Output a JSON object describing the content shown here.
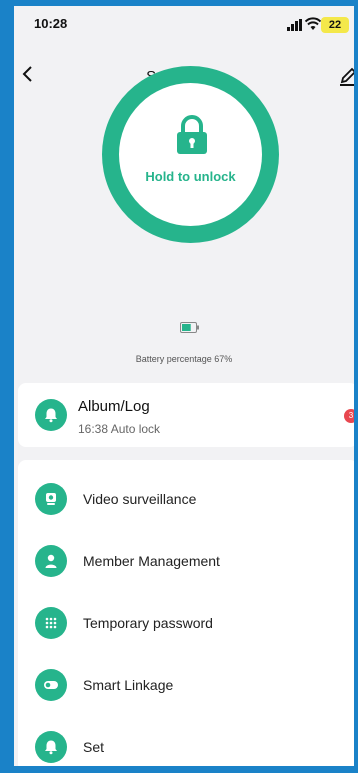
{
  "status_bar": {
    "time": "10:28",
    "battery": "22"
  },
  "nav": {
    "title": "Smart Lock",
    "back_icon": "chevron-left-icon",
    "edit_icon": "pencil-icon"
  },
  "unlock": {
    "label": "Hold to unlock",
    "icon": "lock-icon"
  },
  "battery": {
    "label": "Battery percentage  67%",
    "percent": 67
  },
  "album": {
    "title": "Album/Log",
    "subtitle": "16:38  Auto lock",
    "badge": "3",
    "icon": "bell-icon"
  },
  "menu": {
    "items": [
      {
        "label": "Video surveillance",
        "icon": "camera-icon"
      },
      {
        "label": "Member Management",
        "icon": "person-icon"
      },
      {
        "label": "Temporary password",
        "icon": "keypad-icon"
      },
      {
        "label": "Smart Linkage",
        "icon": "toggle-icon"
      },
      {
        "label": "Set",
        "icon": "bell-icon"
      }
    ]
  },
  "colors": {
    "accent": "#26b48c",
    "badge": "#e8474f",
    "frame": "#1a82c8"
  }
}
